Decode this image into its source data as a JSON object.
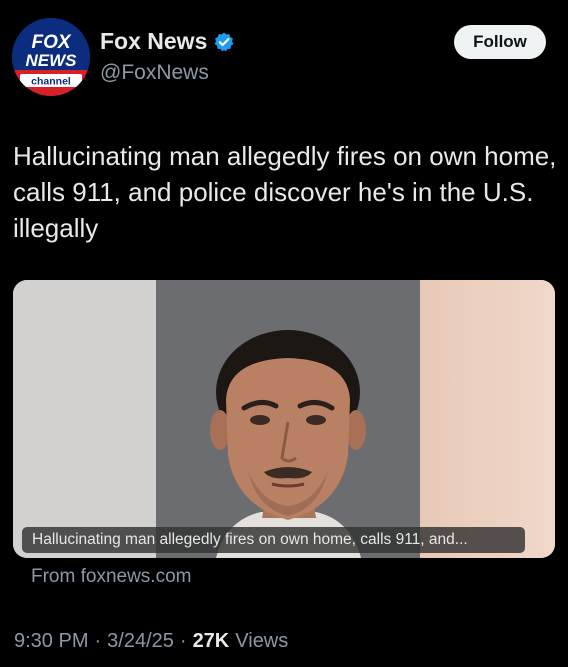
{
  "author": {
    "display_name": "Fox News",
    "handle": "@FoxNews",
    "avatar_label": "FOX NEWS channel",
    "verified": true
  },
  "follow_label": "Follow",
  "tweet": {
    "text": "Hallucinating man allegedly fires on own home, calls 911, and police discover he's in the U.S. illegally"
  },
  "link_card": {
    "caption": "Hallucinating man allegedly fires on own home, calls 911, and...",
    "source": "From foxnews.com"
  },
  "meta": {
    "time": "9:30 PM",
    "date": "3/24/25",
    "separator": "·",
    "views_count": "27K",
    "views_label": "Views"
  },
  "colors": {
    "background": "#000000",
    "text_primary": "#e7e9ea",
    "text_secondary": "#8b98a5",
    "verified_blue": "#1d9bf0",
    "follow_bg": "#eff3f4"
  }
}
